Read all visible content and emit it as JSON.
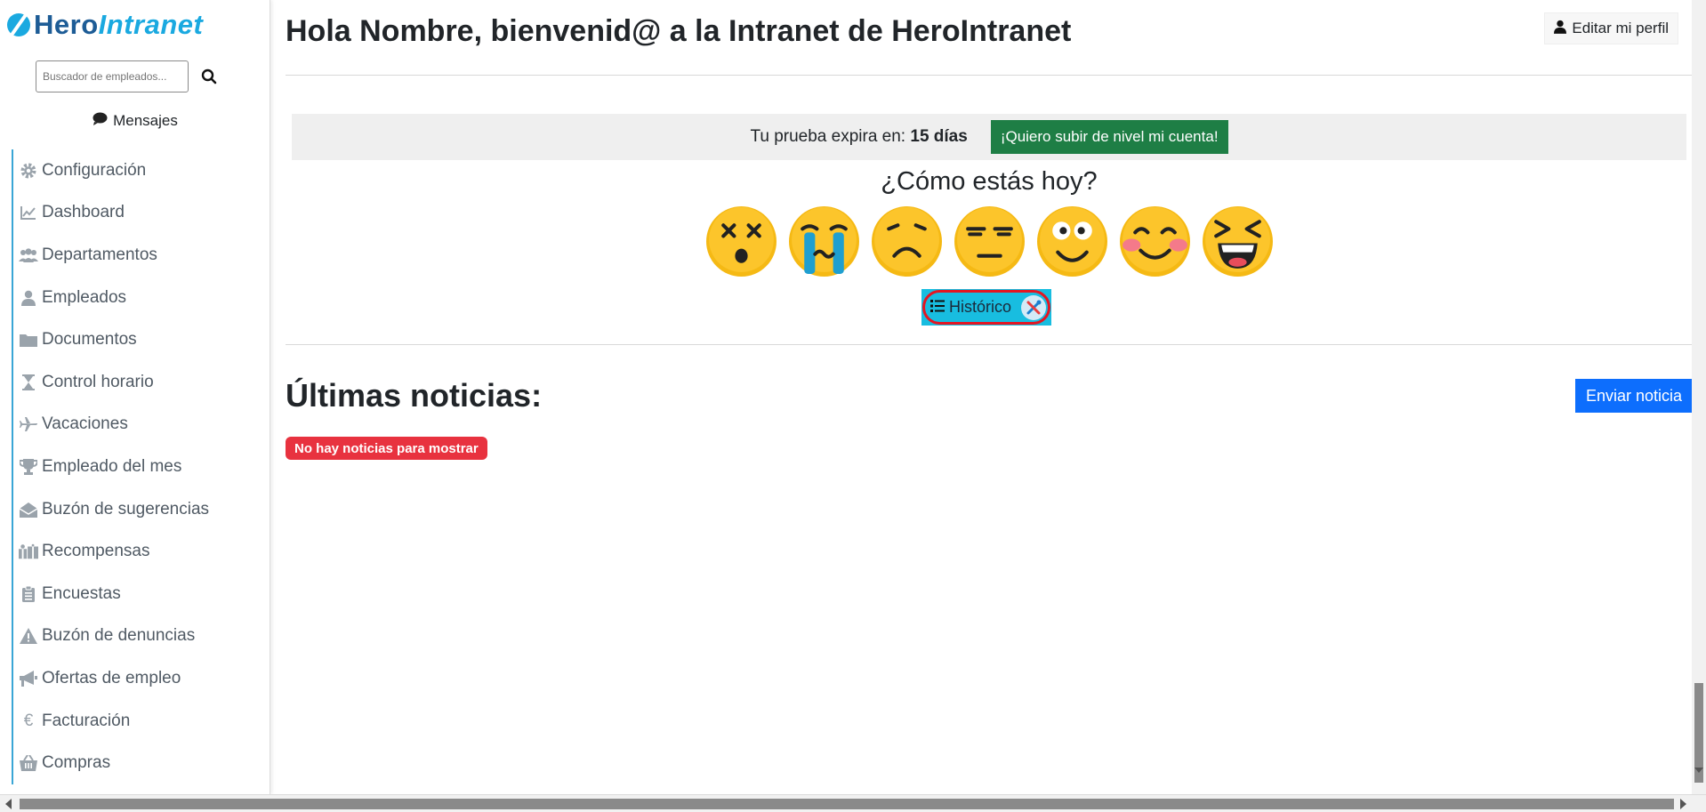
{
  "brand": {
    "hero": "Hero",
    "intranet": "Intranet"
  },
  "search": {
    "placeholder": "Buscador de empleados..."
  },
  "messages": {
    "label": "Mensajes"
  },
  "sidebar": {
    "items": [
      {
        "label": "Configuración",
        "icon": "gear-icon"
      },
      {
        "label": "Dashboard",
        "icon": "chart-line-icon"
      },
      {
        "label": "Departamentos",
        "icon": "users-icon"
      },
      {
        "label": "Empleados",
        "icon": "user-icon"
      },
      {
        "label": "Documentos",
        "icon": "folder-icon"
      },
      {
        "label": "Control horario",
        "icon": "hourglass-icon"
      },
      {
        "label": "Vacaciones",
        "icon": "plane-icon"
      },
      {
        "label": "Empleado del mes",
        "icon": "trophy-icon"
      },
      {
        "label": "Buzón de sugerencias",
        "icon": "envelope-open-icon"
      },
      {
        "label": "Recompensas",
        "icon": "gifts-icon"
      },
      {
        "label": "Encuestas",
        "icon": "clipboard-icon"
      },
      {
        "label": "Buzón de denuncias",
        "icon": "warning-icon"
      },
      {
        "label": "Ofertas de empleo",
        "icon": "bullhorn-icon"
      },
      {
        "label": "Facturación",
        "icon": "euro-icon"
      },
      {
        "label": "Compras",
        "icon": "basket-icon"
      }
    ]
  },
  "header": {
    "greeting_prefix": "Hola ",
    "user_name": "Nombre",
    "greeting_middle": ", bienvenid@ a la Intranet de ",
    "company": "HeroIntranet",
    "edit_profile": "Editar mi perfil"
  },
  "trial": {
    "text": "Tu prueba expira en:",
    "days": "15 días",
    "upgrade_label": "¡Quiero subir de nivel mi cuenta!",
    "upgrade_color": "#1e7e45"
  },
  "mood": {
    "title": "¿Cómo estás hoy?",
    "history_label": "Histórico"
  },
  "news": {
    "title": "Últimas noticias:",
    "send_label": "Enviar noticia",
    "empty_label": "No hay noticias para mostrar",
    "send_color": "#0d6efd",
    "empty_color": "#e8323f"
  }
}
